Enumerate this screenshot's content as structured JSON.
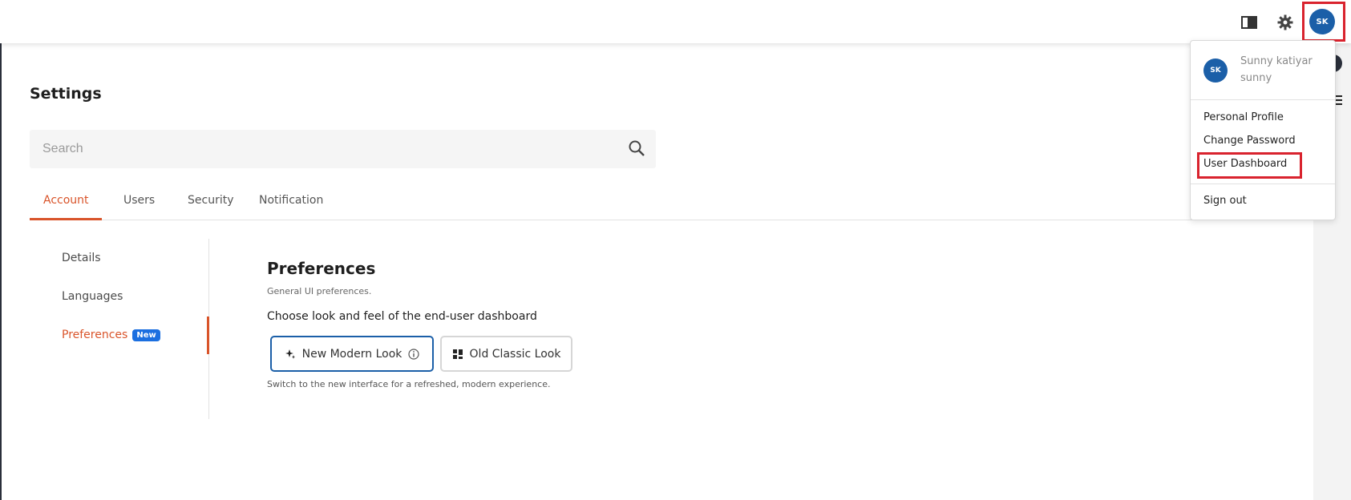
{
  "header": {
    "book_icon": "book-open-icon",
    "settings_icon": "gear-icon",
    "avatar_initials": "SK"
  },
  "page": {
    "title": "Settings"
  },
  "search": {
    "placeholder": "Search",
    "value": ""
  },
  "tabs": [
    {
      "label": "Account",
      "active": true
    },
    {
      "label": "Users",
      "active": false
    },
    {
      "label": "Security",
      "active": false
    },
    {
      "label": "Notification",
      "active": false
    }
  ],
  "subnav": {
    "items": [
      {
        "label": "Details",
        "active": false
      },
      {
        "label": "Languages",
        "active": false
      },
      {
        "label": "Preferences",
        "active": true,
        "badge": "New"
      }
    ]
  },
  "preferences": {
    "title": "Preferences",
    "subtitle": "General UI preferences.",
    "choose_label": "Choose look and feel of the end-user dashboard",
    "options": [
      {
        "label": "New Modern Look",
        "selected": true,
        "icon": "sparkle-icon"
      },
      {
        "label": "Old Classic Look",
        "selected": false,
        "icon": "grid-icon"
      }
    ],
    "note": "Switch to the new interface for a refreshed, modern experience."
  },
  "user_menu": {
    "initials": "SK",
    "name": "Sunny katiyar",
    "username": "sunny",
    "items": [
      {
        "label": "Personal Profile"
      },
      {
        "label": "Change Password"
      },
      {
        "label": "User Dashboard"
      },
      {
        "label": "Sign out"
      }
    ]
  },
  "colors": {
    "accent": "#d9542a",
    "primary": "#1b5fa8",
    "highlight": "#d9232e",
    "badge": "#1b6fe0"
  }
}
